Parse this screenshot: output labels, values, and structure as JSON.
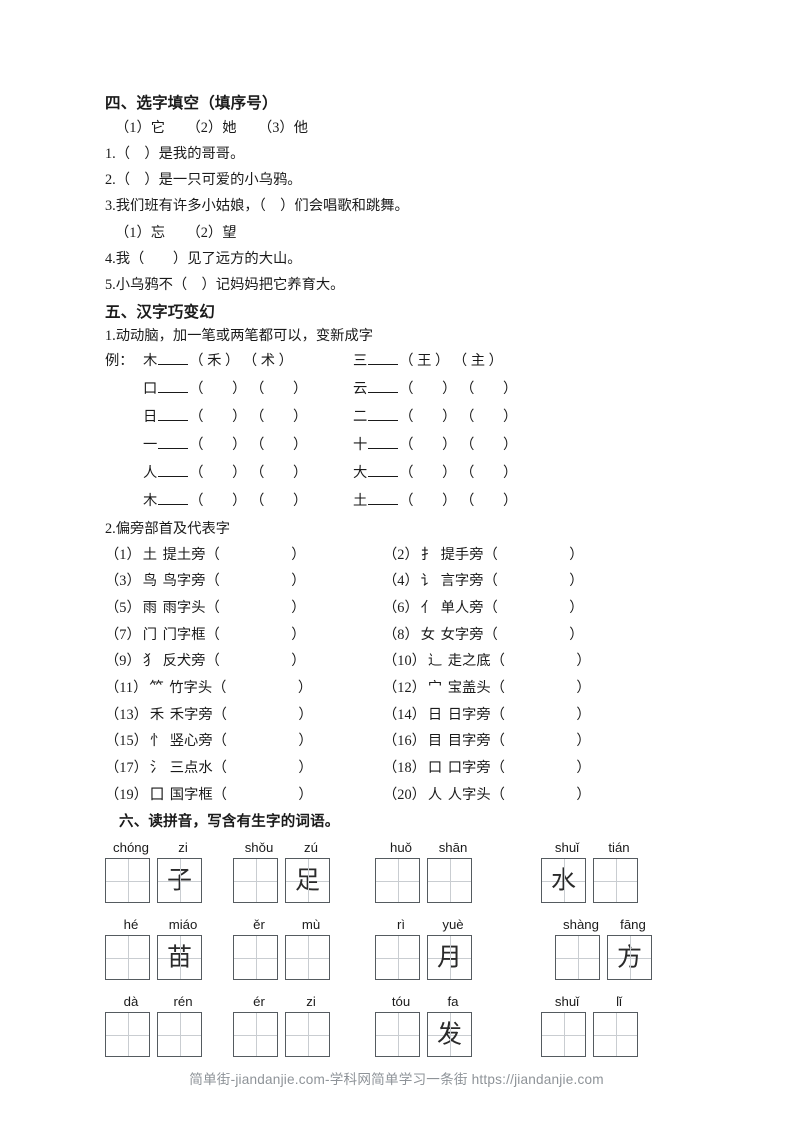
{
  "section4": {
    "heading": "四、选字填空（填序号）",
    "options_a": "（1）它　　（2）她　　（3）他",
    "questions_a": [
      "1.（　）是我的哥哥。",
      "2.（　）是一只可爱的小乌鸦。",
      "3.我们班有许多小姑娘，（　）们会唱歌和跳舞。"
    ],
    "options_b": "（1）忘　　（2）望",
    "questions_b": [
      "4.我（　　）见了远方的大山。",
      "5.小乌鸦不（　）记妈妈把它养育大。"
    ]
  },
  "section5": {
    "heading": "五、汉字巧变幻",
    "sub1": "1.动动脑，加一笔或两笔都可以，变新成字",
    "example_label": "例：",
    "rows": [
      {
        "label": "例：",
        "left_src": "木",
        "left_ans": [
          "禾",
          "术"
        ],
        "right_src": "三",
        "right_ans": [
          "王",
          "主"
        ]
      },
      {
        "label": "",
        "left_src": "口",
        "left_ans": [
          "",
          ""
        ],
        "right_src": "云",
        "right_ans": [
          "",
          ""
        ]
      },
      {
        "label": "",
        "left_src": "日",
        "left_ans": [
          "",
          ""
        ],
        "right_src": "二",
        "right_ans": [
          "",
          ""
        ]
      },
      {
        "label": "",
        "left_src": "一",
        "left_ans": [
          "",
          ""
        ],
        "right_src": "十",
        "right_ans": [
          "",
          ""
        ]
      },
      {
        "label": "",
        "left_src": "人",
        "left_ans": [
          "",
          ""
        ],
        "right_src": "大",
        "right_ans": [
          "",
          ""
        ]
      },
      {
        "label": "",
        "left_src": "木",
        "left_ans": [
          "",
          ""
        ],
        "right_src": "土",
        "right_ans": [
          "",
          ""
        ]
      }
    ],
    "sub2": "2.偏旁部首及代表字",
    "radicals": [
      {
        "num": "（1）",
        "glyph": "土",
        "name": "提土旁（"
      },
      {
        "num": "（2）",
        "glyph": "扌",
        "name": "提手旁（"
      },
      {
        "num": "（3）",
        "glyph": "鸟",
        "name": "鸟字旁（"
      },
      {
        "num": "（4）",
        "glyph": "讠",
        "name": "言字旁（"
      },
      {
        "num": "（5）",
        "glyph": "雨",
        "name": "雨字头（"
      },
      {
        "num": "（6）",
        "glyph": "亻",
        "name": "单人旁（"
      },
      {
        "num": "（7）",
        "glyph": "门",
        "name": "门字框（"
      },
      {
        "num": "（8）",
        "glyph": "女",
        "name": "女字旁（"
      },
      {
        "num": "（9）",
        "glyph": "犭",
        "name": "反犬旁（"
      },
      {
        "num": "（10）",
        "glyph": "辶",
        "name": "走之底（"
      },
      {
        "num": "（11）",
        "glyph": "⺮",
        "name": "竹字头（"
      },
      {
        "num": "（12）",
        "glyph": "宀",
        "name": "宝盖头（"
      },
      {
        "num": "（13）",
        "glyph": "禾",
        "name": "禾字旁（"
      },
      {
        "num": "（14）",
        "glyph": "日",
        "name": "日字旁（"
      },
      {
        "num": "（15）",
        "glyph": "忄",
        "name": "竖心旁（"
      },
      {
        "num": "（16）",
        "glyph": "目",
        "name": "目字旁（"
      },
      {
        "num": "（17）",
        "glyph": "氵",
        "name": "三点水（"
      },
      {
        "num": "（18）",
        "glyph": "口",
        "name": "口字旁（"
      },
      {
        "num": "（19）",
        "glyph": "囗",
        "name": "国字框（"
      },
      {
        "num": "（20）",
        "glyph": "人",
        "name": "人字头（"
      }
    ],
    "close_paren": "）"
  },
  "section6": {
    "heading": "六、读拼音，写含有生字的词语。",
    "rows": [
      {
        "groups": [
          {
            "pinyin": [
              "chóng",
              "zi"
            ],
            "chars": [
              "",
              "子"
            ]
          },
          {
            "pinyin": [
              "shǒu",
              "zú"
            ],
            "chars": [
              "",
              "足"
            ]
          },
          {
            "pinyin": [
              "huǒ",
              "shān"
            ],
            "chars": [
              "",
              ""
            ]
          },
          {
            "pinyin": [
              "shuǐ",
              "tián"
            ],
            "chars": [
              "水",
              ""
            ]
          }
        ]
      },
      {
        "groups": [
          {
            "pinyin": [
              "hé",
              "miáo"
            ],
            "chars": [
              "",
              "苗"
            ]
          },
          {
            "pinyin": [
              "ěr",
              "mù"
            ],
            "chars": [
              "",
              ""
            ]
          },
          {
            "pinyin": [
              "rì",
              "yuè"
            ],
            "chars": [
              "",
              "月"
            ]
          },
          {
            "pinyin": [
              "shàng",
              "fāng"
            ],
            "chars": [
              "",
              "方"
            ]
          }
        ]
      },
      {
        "groups": [
          {
            "pinyin": [
              "dà",
              "rén"
            ],
            "chars": [
              "",
              ""
            ]
          },
          {
            "pinyin": [
              "ér",
              "zi"
            ],
            "chars": [
              "",
              ""
            ]
          },
          {
            "pinyin": [
              "tóu",
              "fa"
            ],
            "chars": [
              "",
              "发"
            ]
          },
          {
            "pinyin": [
              "shuǐ",
              "lǐ"
            ],
            "chars": [
              "",
              ""
            ]
          }
        ]
      }
    ]
  },
  "footer": {
    "text": "简单街-jiandanjie.com-学科网简单学习一条街 https://jiandanjie.com"
  }
}
